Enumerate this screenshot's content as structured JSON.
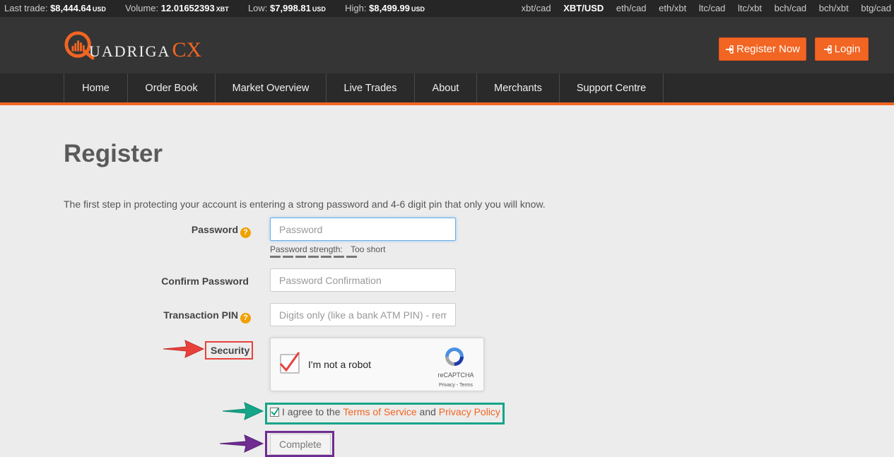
{
  "ticker": {
    "last_trade_label": "Last trade:",
    "last_trade_value": "$8,444.64",
    "last_trade_unit": "USD",
    "volume_label": "Volume:",
    "volume_value": "12.01652393",
    "volume_unit": "XBT",
    "low_label": "Low:",
    "low_value": "$7,998.81",
    "low_unit": "USD",
    "high_label": "High:",
    "high_value": "$8,499.99",
    "high_unit": "USD",
    "markets": [
      "xbt/cad",
      "XBT/USD",
      "eth/cad",
      "eth/xbt",
      "ltc/cad",
      "ltc/xbt",
      "bch/cad",
      "bch/xbt",
      "btg/cad"
    ],
    "active_market": "XBT/USD"
  },
  "header": {
    "logo_main": "UADRIGA",
    "logo_cx": "CX",
    "register_label": "Register Now",
    "login_label": "Login"
  },
  "nav": {
    "items": [
      "Home",
      "Order Book",
      "Market Overview",
      "Live Trades",
      "About",
      "Merchants",
      "Support Centre"
    ]
  },
  "page": {
    "title": "Register",
    "intro": "The first step in protecting your account is entering a strong password and 4-6 digit pin that only you will know."
  },
  "form": {
    "password_label": "Password",
    "password_placeholder": "Password",
    "strength_label": "Password strength:",
    "strength_value": "Too short",
    "confirm_label": "Confirm Password",
    "confirm_placeholder": "Password Confirmation",
    "pin_label": "Transaction PIN",
    "pin_placeholder": "Digits only (like a bank ATM PIN) - remember it",
    "security_label": "Security",
    "captcha_text": "I'm not a robot",
    "captcha_brand": "reCAPTCHA",
    "captcha_links": "Privacy - Terms",
    "agree_prefix": "I agree to the",
    "terms_link": "Terms of Service",
    "agree_and": "and",
    "privacy_link": "Privacy Policy",
    "complete_label": "Complete"
  },
  "colors": {
    "brand_orange": "#f26522",
    "annotation_red": "#e8413c",
    "annotation_teal": "#15a589",
    "annotation_purple": "#6f2c91"
  }
}
